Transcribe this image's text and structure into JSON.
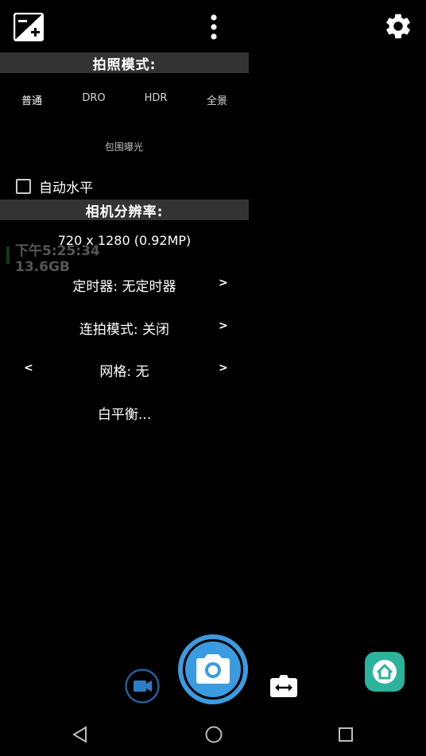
{
  "top_toolbar": {
    "exposure_icon": "exposure-plus-minus-icon",
    "menu_icon": "more-vert-icon",
    "settings_icon": "gear-icon"
  },
  "photo_mode": {
    "header": "拍照模式:",
    "options": [
      "普通",
      "DRO",
      "HDR",
      "全景"
    ],
    "selected": "普通",
    "bracket_label": "包围曝光"
  },
  "auto_level": {
    "label": "自动水平",
    "checked": false
  },
  "camera_resolution": {
    "header": "相机分辨率:",
    "value": "720 x 1280 (0.92MP)"
  },
  "background_overlay": {
    "time": "下午5:25:34",
    "storage": "13.6GB"
  },
  "timer": {
    "label": "定时器: 无定时器",
    "next": ">"
  },
  "burst": {
    "label": "连拍模式: 关闭",
    "next": ">"
  },
  "grid": {
    "label": "网格: 无",
    "prev": "<",
    "next": ">"
  },
  "white_balance": {
    "label": "白平衡..."
  },
  "bottom_controls": {
    "video_icon": "video-camera-icon",
    "shutter_icon": "camera-icon",
    "switch_icon": "switch-camera-icon",
    "home_icon": "home-icon"
  },
  "navigation": {
    "back_icon": "nav-back-icon",
    "home_icon": "nav-home-icon",
    "recents_icon": "nav-recents-icon"
  },
  "colors": {
    "shutter_blue": "#3a9be0",
    "home_green": "#2bb39b",
    "header_bg": "#333333"
  }
}
